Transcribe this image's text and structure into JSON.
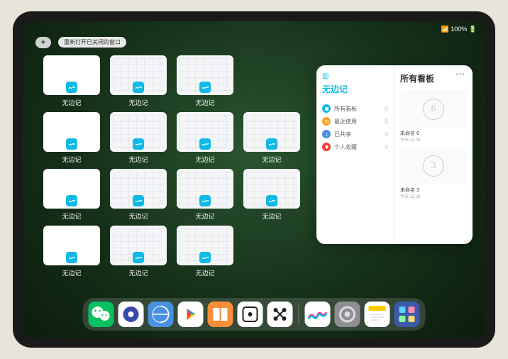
{
  "status": {
    "time": "",
    "indicators": "📶 100% 🔋"
  },
  "topbar": {
    "add_label": "+",
    "reopen_label": "重新打开已关闭的窗口"
  },
  "app_name": "无边记",
  "thumbs": [
    {
      "label": "无边记",
      "type": "blank"
    },
    {
      "label": "无边记",
      "type": "cal"
    },
    {
      "label": "无边记",
      "type": "cal"
    },
    {
      "label": "无边记",
      "type": "blank"
    },
    {
      "label": "无边记",
      "type": "cal"
    },
    {
      "label": "无边记",
      "type": "cal"
    },
    {
      "label": "无边记",
      "type": "cal"
    },
    {
      "label": "无边记",
      "type": "blank"
    },
    {
      "label": "无边记",
      "type": "cal"
    },
    {
      "label": "无边记",
      "type": "cal"
    },
    {
      "label": "无边记",
      "type": "cal"
    },
    {
      "label": "无边记",
      "type": "blank"
    },
    {
      "label": "无边记",
      "type": "cal"
    },
    {
      "label": "无边记",
      "type": "cal"
    }
  ],
  "thumb_slots": [
    0,
    1,
    2,
    null,
    3,
    4,
    5,
    6,
    7,
    8,
    9,
    10,
    11,
    12,
    13
  ],
  "panel": {
    "left_title": "无边记",
    "right_title": "所有看板",
    "items": [
      {
        "label": "所有看板",
        "count": "0",
        "color": "#0fb9e6"
      },
      {
        "label": "最近使用",
        "count": "0",
        "color": "#f5a623"
      },
      {
        "label": "已共享",
        "count": "0",
        "color": "#4a90e2"
      },
      {
        "label": "个人收藏",
        "count": "0",
        "color": "#ff3b30"
      }
    ],
    "boards": [
      {
        "sketch": "6",
        "name": "未命名 6",
        "time": "今天 11:29"
      },
      {
        "sketch": "3",
        "name": "未命名 3",
        "time": "今天 11:28"
      }
    ]
  },
  "dock": [
    {
      "name": "wechat",
      "cls": "di-wechat"
    },
    {
      "name": "quark",
      "cls": "di-blue1"
    },
    {
      "name": "browser",
      "cls": "di-blue2"
    },
    {
      "name": "play",
      "cls": "di-play"
    },
    {
      "name": "books",
      "cls": "di-books"
    },
    {
      "name": "dice",
      "cls": "di-dots1"
    },
    {
      "name": "barcode",
      "cls": "di-dots2"
    },
    {
      "name": "sep"
    },
    {
      "name": "freeform",
      "cls": "di-freeform"
    },
    {
      "name": "settings",
      "cls": "di-settings"
    },
    {
      "name": "notes",
      "cls": "di-notes"
    },
    {
      "name": "appgrid",
      "cls": "di-grid"
    }
  ]
}
